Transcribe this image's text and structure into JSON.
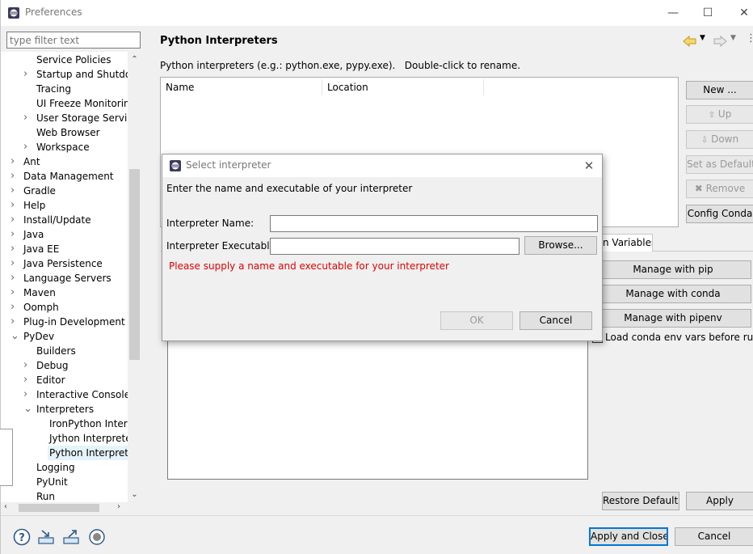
{
  "window": {
    "title": "Preferences",
    "controls": {
      "minimize": "—",
      "maximize": "☐",
      "close": "✕"
    }
  },
  "filter": {
    "placeholder": "type filter text"
  },
  "tree": {
    "items": [
      {
        "label": "Service Policies",
        "level": 2,
        "twisty": ""
      },
      {
        "label": "Startup and Shutdown",
        "level": 2,
        "twisty": ">"
      },
      {
        "label": "Tracing",
        "level": 2,
        "twisty": ""
      },
      {
        "label": "UI Freeze Monitoring",
        "level": 2,
        "twisty": ""
      },
      {
        "label": "User Storage Service",
        "level": 2,
        "twisty": ">"
      },
      {
        "label": "Web Browser",
        "level": 2,
        "twisty": ""
      },
      {
        "label": "Workspace",
        "level": 2,
        "twisty": ">"
      },
      {
        "label": "Ant",
        "level": 1,
        "twisty": ">"
      },
      {
        "label": "Data Management",
        "level": 1,
        "twisty": ">"
      },
      {
        "label": "Gradle",
        "level": 1,
        "twisty": ">"
      },
      {
        "label": "Help",
        "level": 1,
        "twisty": ">"
      },
      {
        "label": "Install/Update",
        "level": 1,
        "twisty": ">"
      },
      {
        "label": "Java",
        "level": 1,
        "twisty": ">"
      },
      {
        "label": "Java EE",
        "level": 1,
        "twisty": ">"
      },
      {
        "label": "Java Persistence",
        "level": 1,
        "twisty": ">"
      },
      {
        "label": "Language Servers",
        "level": 1,
        "twisty": ">"
      },
      {
        "label": "Maven",
        "level": 1,
        "twisty": ">"
      },
      {
        "label": "Oomph",
        "level": 1,
        "twisty": ">"
      },
      {
        "label": "Plug-in Development",
        "level": 1,
        "twisty": ">"
      },
      {
        "label": "PyDev",
        "level": 1,
        "twisty": "v"
      },
      {
        "label": "Builders",
        "level": 2,
        "twisty": ""
      },
      {
        "label": "Debug",
        "level": 2,
        "twisty": ">"
      },
      {
        "label": "Editor",
        "level": 2,
        "twisty": ">"
      },
      {
        "label": "Interactive Console",
        "level": 2,
        "twisty": ">"
      },
      {
        "label": "Interpreters",
        "level": 2,
        "twisty": "v"
      },
      {
        "label": "IronPython Interpreter",
        "level": 3,
        "twisty": ""
      },
      {
        "label": "Jython Interpreter",
        "level": 3,
        "twisty": ""
      },
      {
        "label": "Python Interpreter",
        "level": 3,
        "twisty": "",
        "selected": true
      },
      {
        "label": "Logging",
        "level": 2,
        "twisty": ""
      },
      {
        "label": "PyUnit",
        "level": 2,
        "twisty": ""
      },
      {
        "label": "Run",
        "level": 2,
        "twisty": ""
      }
    ]
  },
  "pane": {
    "title": "Python Interpreters",
    "hint": "Python interpreters (e.g.: python.exe, pypy.exe).   Double-click to rename.",
    "table": {
      "columns": [
        "Name",
        "Location"
      ]
    },
    "buttons": {
      "new": "New ...",
      "up": "Up",
      "down": "Down",
      "set_default": "Set as Default",
      "remove": "Remove",
      "config_conda": "Config Conda"
    },
    "tab_fragment": "n Variables",
    "manage": {
      "pip": "Manage with pip",
      "conda": "Manage with conda",
      "pipenv": "Manage with pipenv"
    },
    "load_conda_checkbox": "Load conda env vars before run?",
    "restore_defaults": "Restore Defaults",
    "apply": "Apply"
  },
  "footer": {
    "apply_and_close": "Apply and Close",
    "cancel": "Cancel"
  },
  "dialog": {
    "title": "Select interpreter",
    "message": "Enter the name and executable of your interpreter",
    "name_label": "Interpreter Name:",
    "name_value": "",
    "exec_label": "Interpreter Executable:",
    "exec_value": "",
    "browse": "Browse...",
    "error": "Please supply a name and executable for your interpreter",
    "ok": "OK",
    "cancel": "Cancel",
    "close": "✕"
  },
  "colors": {
    "error": "#e00000",
    "focus_border": "#0078d7",
    "selection": "#e5f3fb"
  }
}
